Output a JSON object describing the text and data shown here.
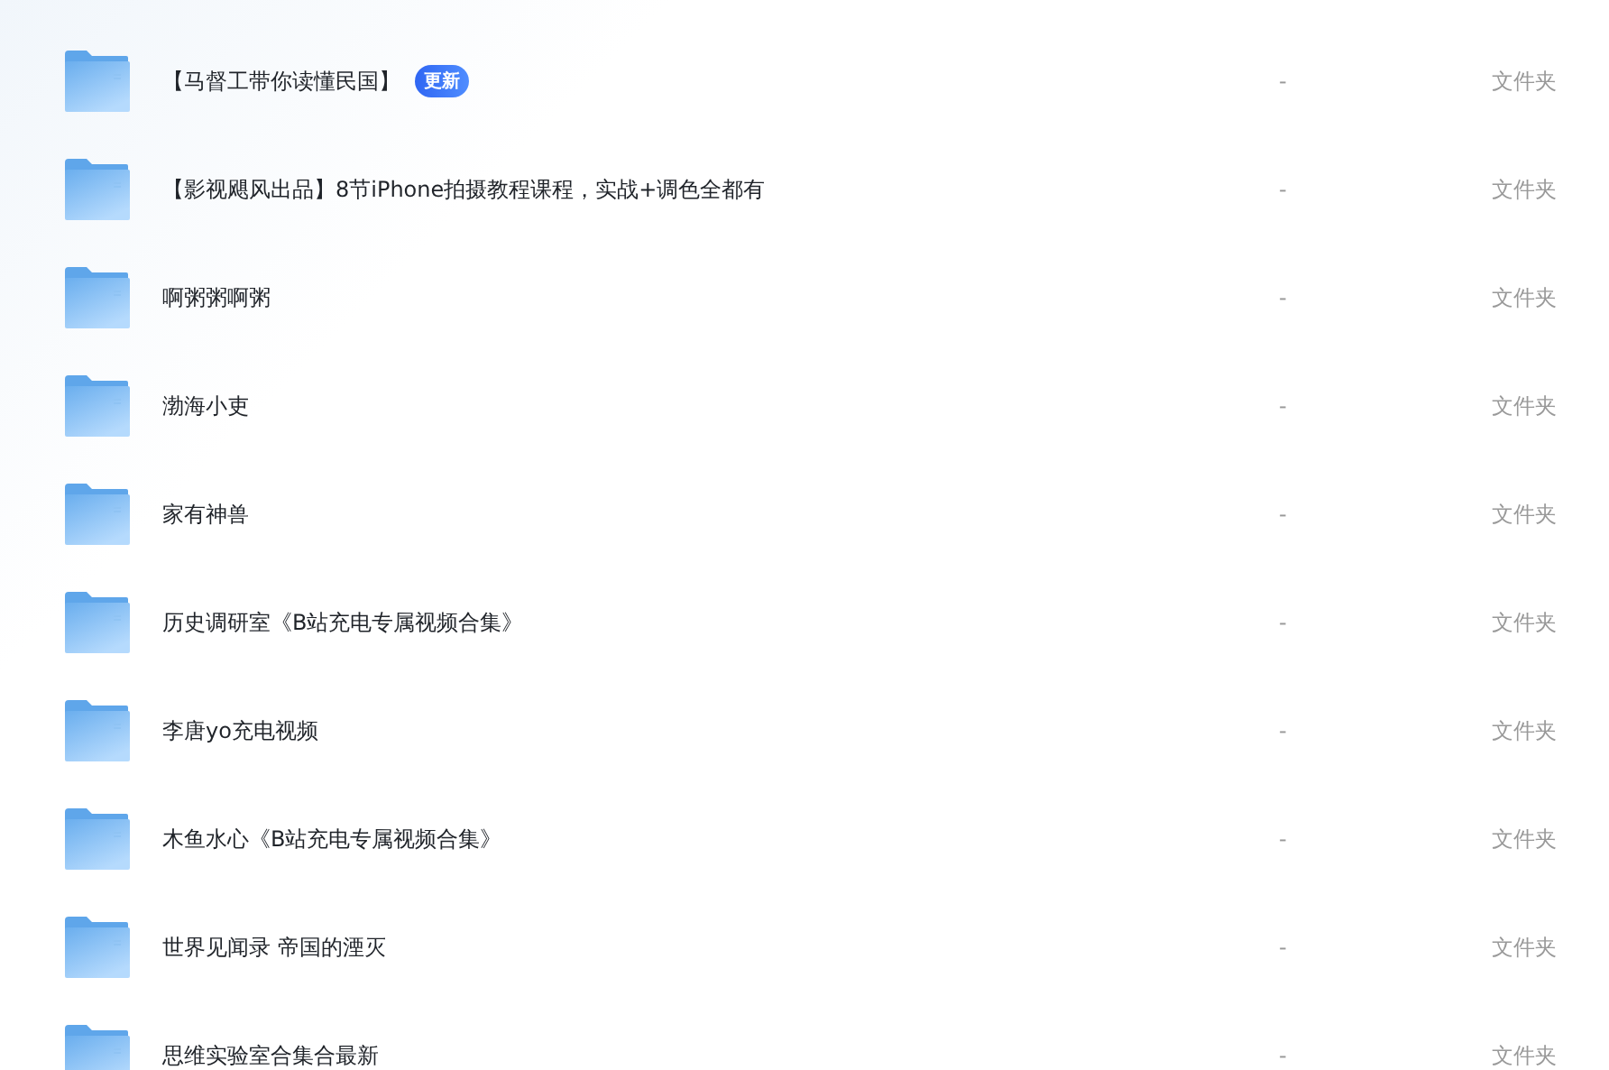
{
  "files": [
    {
      "name": "【马督工带你读懂民国】",
      "badge": "更新",
      "size": "-",
      "type": "文件夹"
    },
    {
      "name": "【影视飓风出品】8节iPhone拍摄教程课程，实战+调色全都有",
      "size": "-",
      "type": "文件夹"
    },
    {
      "name": "啊粥粥啊粥",
      "size": "-",
      "type": "文件夹"
    },
    {
      "name": "渤海小吏",
      "size": "-",
      "type": "文件夹"
    },
    {
      "name": "家有神兽",
      "size": "-",
      "type": "文件夹"
    },
    {
      "name": "历史调研室《B站充电专属视频合集》",
      "size": "-",
      "type": "文件夹"
    },
    {
      "name": "李唐yo充电视频",
      "size": "-",
      "type": "文件夹"
    },
    {
      "name": "木鱼水心《B站充电专属视频合集》",
      "size": "-",
      "type": "文件夹"
    },
    {
      "name": "世界见闻录 帝国的湮灭",
      "size": "-",
      "type": "文件夹"
    },
    {
      "name": "思维实验室合集合最新",
      "size": "-",
      "type": "文件夹"
    }
  ]
}
